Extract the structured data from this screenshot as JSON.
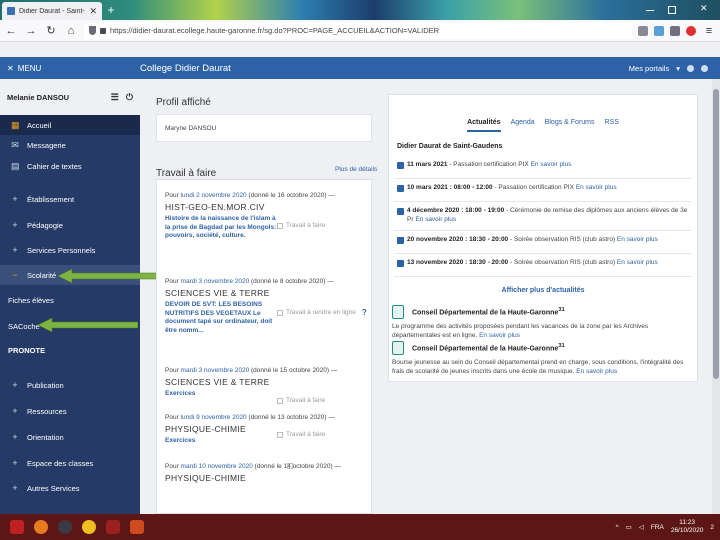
{
  "browser": {
    "tab_title": "Didier Daurat - Saint-Gaudens",
    "url": "https://didier-daurat.ecollege.haute-garonne.fr/sg.do?PROC=PAGE_ACCUEIL&ACTION=VALIDER"
  },
  "header": {
    "menu_label": "MENU",
    "school_name": "College Didier Daurat",
    "portals_label": "Mes portails"
  },
  "user": {
    "name": "Melanie DANSOU"
  },
  "sidebar": {
    "items": [
      {
        "label": "Accueil",
        "icon": "grid-icon"
      },
      {
        "label": "Messagerie",
        "icon": "mail-icon"
      },
      {
        "label": "Cahier de textes",
        "icon": "book-icon"
      },
      {
        "label": "Établissement",
        "icon": "plus-icon"
      },
      {
        "label": "Pédagogie",
        "icon": "plus-icon"
      },
      {
        "label": "Services Personnels",
        "icon": "plus-icon"
      },
      {
        "label": "Scolarité",
        "icon": "minus-icon"
      },
      {
        "label": "Fiches élèves"
      },
      {
        "label": "SACoche"
      },
      {
        "label": "PRONOTE"
      },
      {
        "label": "Publication",
        "icon": "plus-icon"
      },
      {
        "label": "Ressources",
        "icon": "plus-icon"
      },
      {
        "label": "Orientation",
        "icon": "plus-icon"
      },
      {
        "label": "Espace des classes",
        "icon": "plus-icon"
      },
      {
        "label": "Autres Services",
        "icon": "plus-icon"
      }
    ]
  },
  "profile": {
    "title": "Profil affiché",
    "value": "Maryne DANSOU"
  },
  "travail": {
    "title": "Travail à faire",
    "more_link": "Plus de détails",
    "items": [
      {
        "date_prefix": "Pour ",
        "date": "lundi 2 novembre 2020",
        "given": " (donné le 16 octobre 2020) —",
        "subject": "HIST-GEO-EN.MOR.CIV",
        "desc": "Histoire de la naissance de l'islam à la prise de Bagdad par les Mongols: pouvoirs, société, culture.",
        "status": "Travail à faire"
      },
      {
        "date_prefix": "Pour ",
        "date": "mardi 3 novembre 2020",
        "given": " (donné le 8 octobre 2020) —",
        "subject": "SCIENCES VIE & TERRE",
        "desc": "DEVOIR DE SVT: LES BESOINS NUTRITIFS DES VEGETAUX Le document tapé sur ordinateur, doit être nomm...",
        "status": "Travail à rendre en ligne",
        "status_extra": "?"
      },
      {
        "date_prefix": "Pour ",
        "date": "mardi 3 novembre 2020",
        "given": " (donné le 15 octobre 2020) —",
        "subject": "SCIENCES VIE & TERRE",
        "desc": "Exercices",
        "status": "Travail à faire"
      },
      {
        "date_prefix": "Pour ",
        "date": "lundi 9 novembre 2020",
        "given": " (donné le 13 octobre 2020) —",
        "subject": "PHYSIQUE-CHIMIE",
        "desc": "Exercices",
        "status": "Travail à faire"
      },
      {
        "date_prefix": "Pour ",
        "date": "mardi 10 novembre 2020",
        "given": " (donné le 14 octobre 2020) —",
        "subject": "PHYSIQUE-CHIMIE",
        "desc": "",
        "status": ""
      }
    ]
  },
  "news": {
    "tabs": [
      "Actualités",
      "Agenda",
      "Blogs & Forums",
      "RSS"
    ],
    "heading": "Didier Daurat de Saint-Gaudens",
    "rows": [
      {
        "date": "11 mars 2021",
        "text": " - Passation certification PIX ",
        "link": "En savoir plus"
      },
      {
        "date": "10 mars 2021 : 08:00 - 12:00",
        "text": " - Passation certification PIX ",
        "link": "En savoir plus"
      },
      {
        "date": "4 décembre 2020 : 18:00 - 19:00",
        "text": " - Cérémonie de remise des diplômes aux anciens élèves de 3e Pr",
        "link": "En savoir plus"
      },
      {
        "date": "20 novembre 2020 : 18:30 - 20:00",
        "text": " - Soirée observation  RIS (club astro) ",
        "link": "En savoir plus"
      },
      {
        "date": "13 novembre 2020 : 18:30 - 20:00",
        "text": " - Soirée observation  RIS (club astro) ",
        "link": "En savoir plus"
      }
    ],
    "more_link": "Afficher plus d'actualités"
  },
  "cd31": [
    {
      "title": "Conseil Départemental de la Haute-Garonne",
      "sup": "31",
      "text": "Le programme des activités proposées pendant les vacances de la zone par les Archives départementales est en ligne. ",
      "link": "En savoir plus"
    },
    {
      "title": "Conseil Départemental de la Haute-Garonne",
      "sup": "31",
      "text": "Bourse jeunesse au sein du Conseil départemental prend en charge, sous conditions, l'intégralité des frais de scolarité de jeunes inscrits dans une école de musique. ",
      "link": "En savoir plus"
    }
  ],
  "taskbar": {
    "time": "11:23",
    "date": "26/10/2020",
    "lang": "FRA",
    "notif": "2"
  },
  "colors": {
    "header_blue": "#2e62a7",
    "sidebar_navy": "#253a66",
    "taskbar": "#5c1616",
    "arrow_green": "#7cb342"
  }
}
